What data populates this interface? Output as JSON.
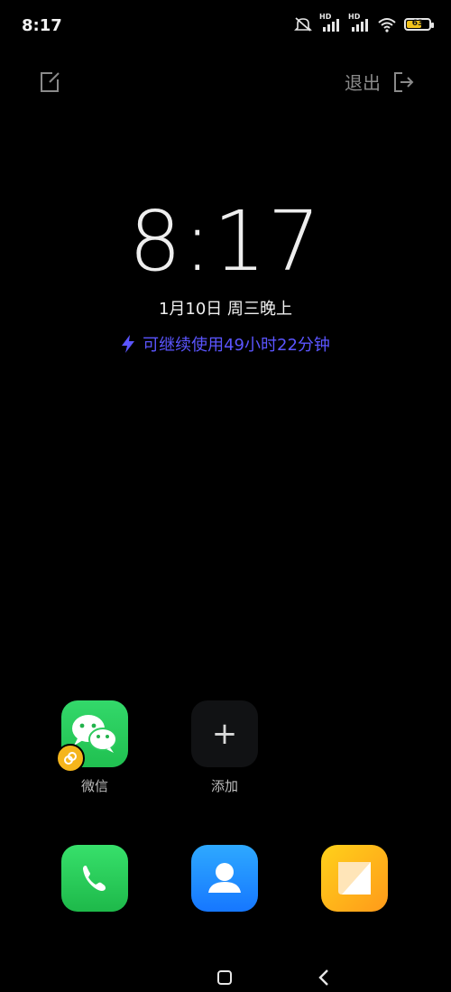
{
  "status_bar": {
    "time": "8:17",
    "signal1_label": "HD",
    "signal2_label": "HD",
    "battery_level": "63",
    "icons": [
      "mute-icon",
      "signal-icon",
      "signal-icon",
      "wifi-icon",
      "battery-icon"
    ]
  },
  "top_bar": {
    "exit_label": "退出",
    "icons": [
      "edit-icon",
      "exit-icon"
    ]
  },
  "lock": {
    "clock": "8:17",
    "date": "1月10日 周三晚上",
    "battery_life": "可继续使用49小时22分钟",
    "accent_color": "#5b55ff"
  },
  "apps": [
    {
      "label": "微信",
      "icon": "wechat-icon",
      "badge_icon": "dual-app-icon"
    },
    {
      "label": "添加",
      "icon": "plus-icon"
    }
  ],
  "dock": [
    {
      "icon": "phone-icon"
    },
    {
      "icon": "contacts-icon"
    },
    {
      "icon": "notes-icon"
    }
  ],
  "nav": [
    "home-button",
    "back-button"
  ]
}
